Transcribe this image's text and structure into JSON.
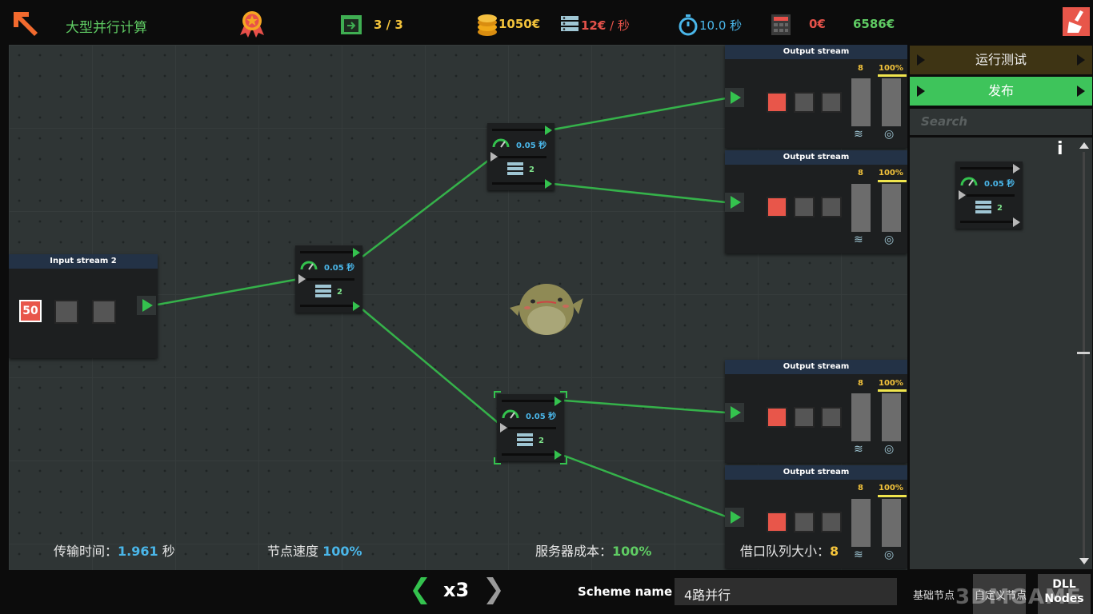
{
  "topbar": {
    "title": "大型并行计算",
    "level_progress": "3 / 3",
    "coins": "1050€",
    "server_cost": "12€",
    "server_cost_unit": " / 秒",
    "time": "10.0 秒",
    "cost_zero": "0€",
    "total": "6586€"
  },
  "input_node": {
    "header": "Input stream 2",
    "value": "50"
  },
  "split_nodes": [
    {
      "speed": "0.05 秒",
      "count": "2"
    },
    {
      "speed": "0.05 秒",
      "count": "2"
    },
    {
      "speed": "0.05 秒",
      "count": "2"
    }
  ],
  "output_nodes": [
    {
      "header": "Output stream",
      "count": "8",
      "percent": "100%"
    },
    {
      "header": "Output stream",
      "count": "8",
      "percent": "100%"
    },
    {
      "header": "Output stream",
      "count": "8",
      "percent": "100%"
    },
    {
      "header": "Output stream",
      "count": "8",
      "percent": "100%"
    }
  ],
  "stats": {
    "transfer_label": "传输时间：",
    "transfer_value": "1.961",
    "transfer_unit": "秒",
    "node_speed_label": "节点速度",
    "node_speed_value": "100%",
    "server_cost_label": "服务器成本：",
    "server_cost_value": "100%",
    "queue_label": "借口队列大小：",
    "queue_value": "8"
  },
  "bottom": {
    "speed_multiplier": "x3",
    "scheme_label": "Scheme name :",
    "scheme_value": "4路并行"
  },
  "panel": {
    "run_test": "运行测试",
    "publish": "发布",
    "search_placeholder": "Search",
    "info": "i",
    "palette_node": {
      "speed": "0.05 秒",
      "count": "2"
    },
    "tabs": [
      "基础节点",
      "自定义节点",
      "DLL\nNodes"
    ]
  },
  "watermark": "3DMGAME",
  "colors": {
    "link": "#35b24a",
    "accent_green": "#34c24e",
    "publish_bg": "#3ec45b",
    "run_bg": "#3e3414",
    "speed_blue": "#4ab6e9",
    "gold": "#f3c33b"
  }
}
